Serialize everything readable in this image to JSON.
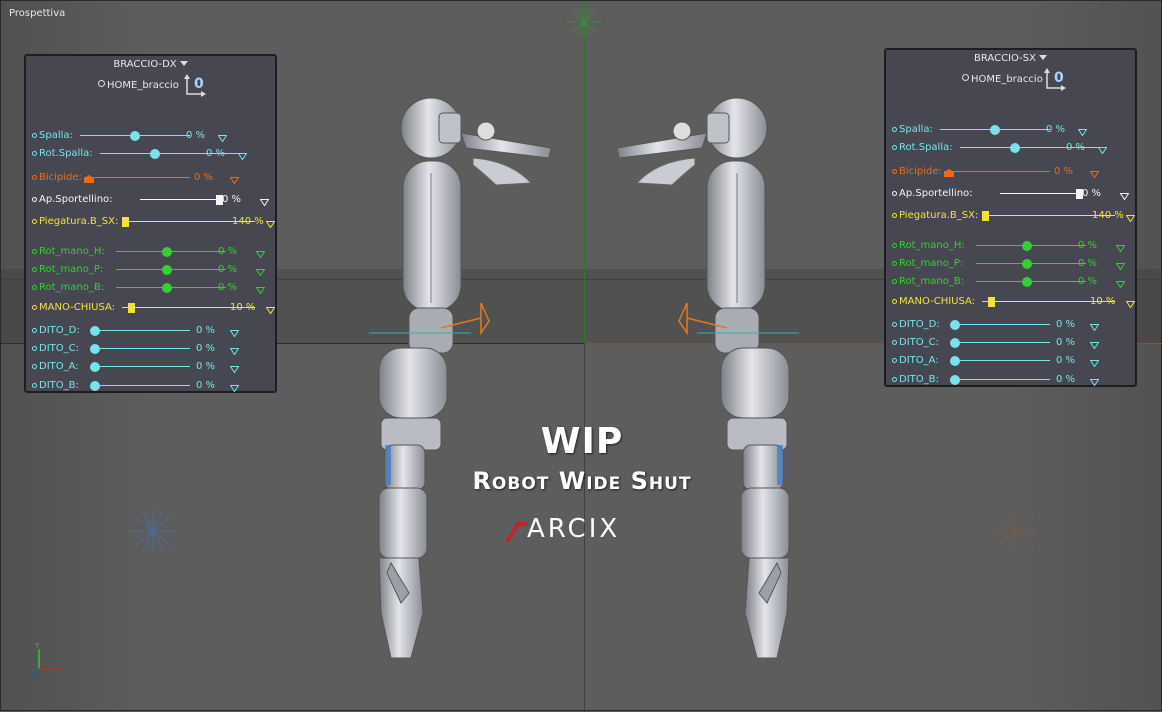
{
  "viewport": {
    "label": "Prospettiva"
  },
  "panels": [
    {
      "title": "BRACCIO-DX",
      "home_label": "HOME_braccio",
      "zero_label": "0",
      "rows": [
        {
          "label": "Spalla:",
          "value": "0 %",
          "color": "#77e3ea"
        },
        {
          "label": "Rot.Spalla:",
          "value": "0 %",
          "color": "#77e3ea"
        },
        {
          "label": "Bicipide:",
          "value": "0 %",
          "color": "#ef6a13"
        },
        {
          "label": "Ap.Sportellino:",
          "value": "0 %",
          "color": "#f4f4f4"
        },
        {
          "label": "Piegatura.B_SX:",
          "value": "140 %",
          "color": "#f2e23a"
        },
        {
          "label": "Rot_mano_H:",
          "value": "0 %",
          "color": "#33d12c"
        },
        {
          "label": "Rot_mano_P:",
          "value": "0 %",
          "color": "#33d12c"
        },
        {
          "label": "Rot_mano_B:",
          "value": "0 %",
          "color": "#33d12c"
        },
        {
          "label": "MANO-CHIUSA:",
          "value": "10 %",
          "color": "#f2e23a"
        },
        {
          "label": "DITO_D:",
          "value": "0 %",
          "color": "#77e3ea"
        },
        {
          "label": "DITO_C:",
          "value": "0 %",
          "color": "#77e3ea"
        },
        {
          "label": "DITO_A:",
          "value": "0 %",
          "color": "#77e3ea"
        },
        {
          "label": "DITO_B:",
          "value": "0 %",
          "color": "#77e3ea"
        }
      ]
    },
    {
      "title": "BRACCIO-SX",
      "home_label": "HOME_braccio",
      "zero_label": "0",
      "rows": [
        {
          "label": "Spalla:",
          "value": "0 %",
          "color": "#77e3ea"
        },
        {
          "label": "Rot.Spalla:",
          "value": "0 %",
          "color": "#77e3ea"
        },
        {
          "label": "Bicipide:",
          "value": "0 %",
          "color": "#ef6a13"
        },
        {
          "label": "Ap.Sportellino:",
          "value": "0 %",
          "color": "#f4f4f4"
        },
        {
          "label": "Piegatura.B_SX:",
          "value": "140 %",
          "color": "#f2e23a"
        },
        {
          "label": "Rot_mano_H:",
          "value": "0 %",
          "color": "#33d12c"
        },
        {
          "label": "Rot_mano_P:",
          "value": "0 %",
          "color": "#33d12c"
        },
        {
          "label": "Rot_mano_B:",
          "value": "0 %",
          "color": "#33d12c"
        },
        {
          "label": "MANO-CHIUSA:",
          "value": "10 %",
          "color": "#f2e23a"
        },
        {
          "label": "DITO_D:",
          "value": "0 %",
          "color": "#77e3ea"
        },
        {
          "label": "DITO_C:",
          "value": "0 %",
          "color": "#77e3ea"
        },
        {
          "label": "DITO_A:",
          "value": "0 %",
          "color": "#77e3ea"
        },
        {
          "label": "DITO_B:",
          "value": "0 %",
          "color": "#77e3ea"
        }
      ]
    }
  ],
  "overlay": {
    "title": "WIP",
    "subtitle": "Robot Wide Shut",
    "brand": "ARCIX",
    "brand_accent": "#c8202a"
  },
  "axis_widget": {
    "x": "X",
    "y": "Y",
    "z": "Z"
  }
}
